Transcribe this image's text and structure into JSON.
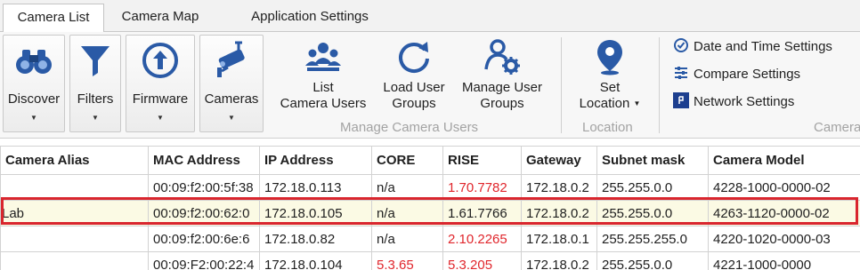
{
  "tabs": [
    {
      "label": "Camera List",
      "active": true
    },
    {
      "label": "Camera Map",
      "active": false
    },
    {
      "label": "Application Settings",
      "active": false
    }
  ],
  "ribbon": {
    "discover_label": "Discover",
    "filters_label": "Filters",
    "firmware_label": "Firmware",
    "cameras_label": "Cameras",
    "list_users_label_1": "List",
    "list_users_label_2": "Camera Users",
    "load_groups_label_1": "Load User",
    "load_groups_label_2": "Groups",
    "manage_groups_label_1": "Manage User",
    "manage_groups_label_2": "Groups",
    "manage_users_caption": "Manage Camera Users",
    "set_location_label_1": "Set",
    "set_location_label_2": "Location",
    "location_caption": "Location",
    "date_time_label": "Date and Time Settings",
    "compare_label": "Compare Settings",
    "network_label": "Network Settings",
    "camera_caption_partial": "Camera",
    "dropdown_caret": "▼"
  },
  "grid": {
    "columns": [
      "Camera Alias",
      "MAC Address",
      "IP Address",
      "CORE",
      "RISE",
      "Gateway",
      "Subnet mask",
      "Camera Model"
    ],
    "rows": [
      {
        "alias": "",
        "mac": "00:09:f2:00:5f:38",
        "ip": "172.18.0.113",
        "core": "n/a",
        "rise": "1.70.7782",
        "gateway": "172.18.0.2",
        "subnet": "255.255.0.0",
        "model": "4228-1000-0000-02"
      },
      {
        "alias": "Lab",
        "mac": "00:09:f2:00:62:0",
        "ip": "172.18.0.105",
        "core": "n/a",
        "rise": "1.61.7766",
        "gateway": "172.18.0.2",
        "subnet": "255.255.0.0",
        "model": "4263-1120-0000-02"
      },
      {
        "alias": "",
        "mac": "00:09:f2:00:6e:6",
        "ip": "172.18.0.82",
        "core": "n/a",
        "rise": "2.10.2265",
        "gateway": "172.18.0.1",
        "subnet": "255.255.255.0",
        "model": "4220-1020-0000-03"
      },
      {
        "alias": "",
        "mac": "00:09:F2:00:22:4",
        "ip": "172.18.0.104",
        "core": "5.3.65",
        "rise": "5.3.205",
        "gateway": "172.18.0.2",
        "subnet": "255.255.0.0",
        "model": "4221-1000-0000"
      }
    ]
  },
  "colors": {
    "icon_blue": "#2a5aa6",
    "warning_red": "#e0262c",
    "selection_outline": "#d9262e",
    "selected_row_bg": "#fbfae4"
  },
  "icons": {
    "discover": "binoculars-icon",
    "filters": "funnel-icon",
    "firmware": "upload-circle-icon",
    "cameras": "security-camera-icon",
    "list_users": "user-group-icon",
    "load_groups": "refresh-icon",
    "manage_groups": "user-gear-icon",
    "set_location": "map-pin-icon",
    "date_time": "clock-check-icon",
    "compare": "compare-sliders-icon",
    "network": "network-icon"
  }
}
